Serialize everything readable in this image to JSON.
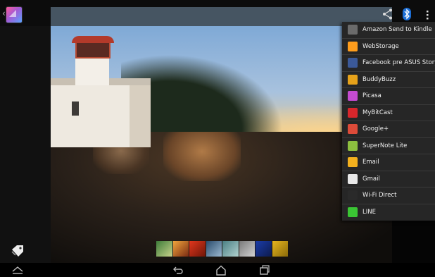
{
  "app": {
    "title_icon": "gallery-app-icon",
    "back_icon": "chevron-left-icon"
  },
  "toolbar": {
    "share_icon": "share-icon",
    "bluetooth_icon": "bluetooth-icon",
    "overflow_icon": "overflow-menu-icon"
  },
  "share_menu": {
    "items": [
      {
        "label": "Amazon Send to Kindle",
        "icon": "kindle-icon",
        "color": "#6b6b6b"
      },
      {
        "label": "WebStorage",
        "icon": "webstorage-icon",
        "color": "#ff9d1c"
      },
      {
        "label": "Facebook pre ASUS Story",
        "icon": "asus-story-icon",
        "color": "#3b5998"
      },
      {
        "label": "BuddyBuzz",
        "icon": "buddybuzz-icon",
        "color": "#e6a21a"
      },
      {
        "label": "Picasa",
        "icon": "picasa-icon",
        "color": "#c44bd1"
      },
      {
        "label": "MyBitCast",
        "icon": "mybitcast-icon",
        "color": "#d8262b"
      },
      {
        "label": "Google+",
        "icon": "google-plus-icon",
        "color": "#dd4b39"
      },
      {
        "label": "SuperNote Lite",
        "icon": "supernote-icon",
        "color": "#8dbf3f"
      },
      {
        "label": "Email",
        "icon": "email-icon",
        "color": "#f2b01e"
      },
      {
        "label": "Gmail",
        "icon": "gmail-icon",
        "color": "#e8e8e8"
      },
      {
        "label": "Wi-Fi Direct",
        "icon": "wifi-direct-icon",
        "color": "#2a2a2a"
      },
      {
        "label": "LINE",
        "icon": "line-icon",
        "color": "#3ac534"
      }
    ]
  },
  "thumbnails": [
    {
      "name": "thumb-1",
      "colors": [
        "#3e7d3a",
        "#c7d28a"
      ]
    },
    {
      "name": "thumb-2",
      "colors": [
        "#f0a43c",
        "#7b2b12"
      ]
    },
    {
      "name": "thumb-3",
      "colors": [
        "#e2371d",
        "#6e1608"
      ]
    },
    {
      "name": "thumb-4",
      "colors": [
        "#2a4c6d",
        "#9ab7cf"
      ]
    },
    {
      "name": "thumb-5",
      "colors": [
        "#4a7f84",
        "#b2d2cf"
      ]
    },
    {
      "name": "thumb-6",
      "colors": [
        "#7a7a7a",
        "#d2d2d2"
      ]
    },
    {
      "name": "thumb-7",
      "colors": [
        "#1b3ca8",
        "#0d1b4d"
      ]
    },
    {
      "name": "thumb-8",
      "colors": [
        "#e7b51e",
        "#8a6a0a"
      ]
    }
  ],
  "navbar": {
    "expand_icon": "expand-up-icon",
    "back_icon": "back-icon",
    "home_icon": "home-icon",
    "recents_icon": "recent-apps-icon"
  },
  "left_panel": {
    "tag_icon": "tag-icon"
  }
}
